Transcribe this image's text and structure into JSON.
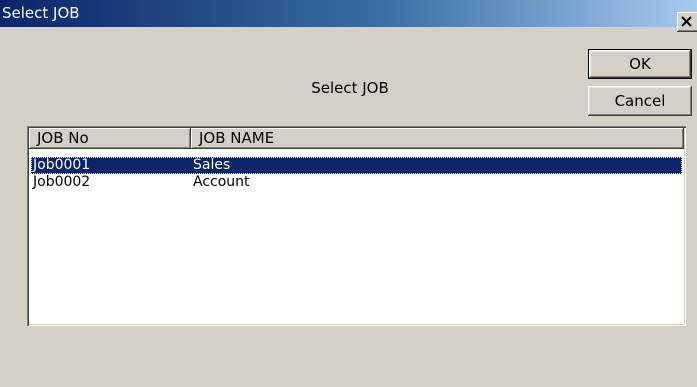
{
  "window": {
    "title": "Select JOB"
  },
  "dialog": {
    "prompt": "Select JOB",
    "ok_label": "OK",
    "cancel_label": "Cancel"
  },
  "list": {
    "columns": [
      "JOB No",
      "JOB NAME"
    ],
    "rows": [
      {
        "no": "Job0001",
        "name": "Sales",
        "selected": true
      },
      {
        "no": "Job0002",
        "name": "Account",
        "selected": false
      }
    ]
  },
  "colors": {
    "title_start": "#0a246a",
    "title_end": "#a6caf0",
    "selection": "#0a246a",
    "face": "#d4d0c8"
  }
}
